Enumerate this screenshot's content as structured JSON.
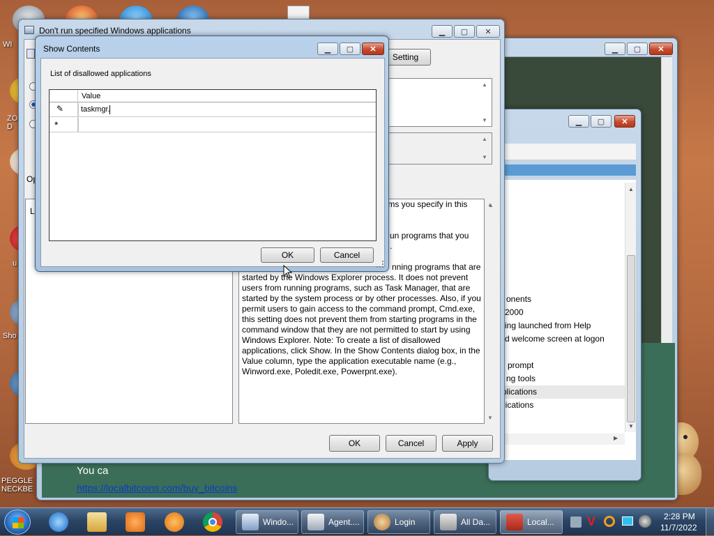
{
  "desktop": {
    "icons": [
      {
        "label": "WI"
      },
      {
        "label": "ZO\nD"
      },
      {
        "label": "u"
      },
      {
        "label": "Sho"
      },
      {
        "label": "PEGGLE\nNECKBE"
      }
    ]
  },
  "bg_window_right": {
    "items": [
      "onents",
      "2000",
      "ing launched from Help",
      "d welcome screen at logon",
      "prompt",
      "ng tools",
      "plications",
      "lications"
    ]
  },
  "bg_window_bottom": {
    "text": "You ca",
    "link": "https://localbitcoins.com/buy_bitcoins"
  },
  "policy_window": {
    "title": "Don't run specified Windows applications",
    "setting_button": "Setting",
    "options_label": "Op",
    "left_panel_label": "Li",
    "help_lines": [
      "grams you specify in this",
      "",
      "un programs that you",
      ".",
      "nning programs that are",
      "started by the Windows Explorer process. It does not prevent",
      "users from running programs, such as Task Manager, that are",
      "started by the system process or by other processes. Also, if you",
      "permit users to gain access to the command prompt, Cmd.exe,",
      "this setting does not prevent them from starting programs in the",
      "command window that they are not permitted to start by using",
      "Windows Explorer. Note: To create a list of disallowed",
      "applications, click Show. In the Show Contents dialog box, in the",
      "Value column, type the application executable name (e.g.,",
      "Winword.exe, Poledit.exe, Powerpnt.exe)."
    ],
    "ok": "OK",
    "cancel": "Cancel",
    "apply": "Apply"
  },
  "show_contents": {
    "title": "Show Contents",
    "list_label": "List of disallowed applications",
    "column_header": "Value",
    "row1_value": "taskmgr.",
    "new_row_marker": "*",
    "ok": "OK",
    "cancel": "Cancel"
  },
  "taskbar": {
    "buttons": [
      "Windo...",
      "Agent....",
      "Login",
      "All Da...",
      "Local..."
    ],
    "time": "2:28 PM",
    "date": "11/7/2022"
  },
  "colors": {
    "accent": "#2c4565",
    "close_button": "#c44a2e",
    "link": "#0a3cc2"
  }
}
